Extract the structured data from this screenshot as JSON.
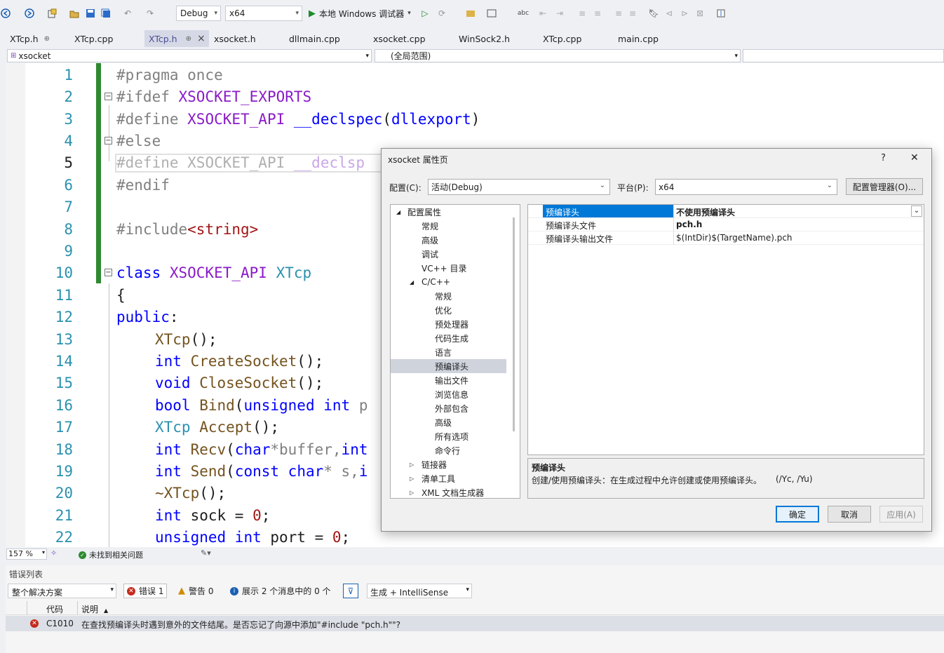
{
  "toolbar": {
    "config": "Debug",
    "platform": "x64",
    "run_label": "本地 Windows 调试器"
  },
  "tabs": [
    {
      "label": "XTcp.h",
      "pin": "⊕"
    },
    {
      "label": "XTcp.cpp"
    },
    {
      "label": "XTcp.h",
      "pin": "⊕",
      "close": "×"
    },
    {
      "label": "xsocket.h"
    },
    {
      "label": "dllmain.cpp"
    },
    {
      "label": "xsocket.cpp"
    },
    {
      "label": "WinSock2.h"
    },
    {
      "label": "XTcp.cpp"
    },
    {
      "label": "main.cpp"
    }
  ],
  "navbar": {
    "project": "xsocket",
    "scope": "(全局范围)"
  },
  "editor": {
    "current_line": "5",
    "line_numbers": [
      "1",
      "2",
      "3",
      "4",
      "5",
      "6",
      "7",
      "8",
      "9",
      "10",
      "11",
      "12",
      "13",
      "14",
      "15",
      "16",
      "17",
      "18",
      "19",
      "20",
      "21",
      "22"
    ],
    "lines": {
      "l1": {
        "a": "#pragma once"
      },
      "l2": {
        "a": "#ifdef ",
        "b": "XSOCKET_EXPORTS"
      },
      "l3": {
        "a": "#define ",
        "b": "XSOCKET_API",
        "c": " ",
        "d": "__declspec",
        "e": "(",
        "f": "dllexport",
        "g": ")"
      },
      "l4": {
        "a": "#else"
      },
      "l5": {
        "a": "#define ",
        "b": "XSOCKET_API",
        "c": " ",
        "d": "__declsp"
      },
      "l6": {
        "a": "#endif"
      },
      "l8": {
        "a": "#include",
        "b": "<string>"
      },
      "l10": {
        "a": "class ",
        "b": "XSOCKET_API",
        "c": " ",
        "d": "XTcp"
      },
      "l11": {
        "a": "{"
      },
      "l12": {
        "a": "public",
        ":": ":"
      },
      "l13": {
        "a": "XTcp",
        "b": "();"
      },
      "l14": {
        "a": "int ",
        "b": "CreateSocket",
        "c": "();"
      },
      "l15": {
        "a": "void ",
        "b": "CloseSocket",
        "c": "();"
      },
      "l16": {
        "a": "bool ",
        "b": "Bind",
        "c": "(",
        "d": "unsigned ",
        "e": "int ",
        "f": "p"
      },
      "l17": {
        "a": "XTcp ",
        "b": "Accept",
        "c": "();"
      },
      "l18": {
        "a": "int ",
        "b": "Recv",
        "c": "(",
        "d": "char",
        "e": "*buffer,",
        "f": "int"
      },
      "l19": {
        "a": "int ",
        "b": "Send",
        "c": "(",
        "d": "const ",
        "e": "char",
        "f": "* s,",
        "g": "i"
      },
      "l20": {
        "a": "~XTcp",
        "b": "();"
      },
      "l21": {
        "a": "int ",
        "b": "sock = ",
        "c": "0",
        ";": ";"
      },
      "l22": {
        "a": "unsigned ",
        "b": "int ",
        "c": "port = ",
        "d": "0",
        ";": ";"
      }
    }
  },
  "status": {
    "zoom": "157 %",
    "issues": "未找到相关问题"
  },
  "errors": {
    "panel_title": "错误列表",
    "scope": "整个解决方案",
    "errors_btn": "错误 1",
    "warnings_btn": "警告 0",
    "messages_btn": "展示 2 个消息中的 0 个",
    "build_filter": "生成 + IntelliSense",
    "col_code": "代码",
    "col_desc": "说明",
    "sort_arrow": "▲",
    "rows": [
      {
        "code": "C1010",
        "desc": "在查找预编译头时遇到意外的文件结尾。是否忘记了向源中添加\"#include \"pch.h\"\"?"
      }
    ]
  },
  "dialog": {
    "title": "xsocket 属性页",
    "help": "?",
    "close": "✕",
    "config_label": "配置(C):",
    "config_value": "活动(Debug)",
    "platform_label": "平台(P):",
    "platform_value": "x64",
    "config_manager": "配置管理器(O)...",
    "tree": [
      {
        "label": "配置属性",
        "exp": "◢"
      },
      {
        "label": "常规"
      },
      {
        "label": "高级"
      },
      {
        "label": "调试"
      },
      {
        "label": "VC++ 目录"
      },
      {
        "label": "C/C++",
        "exp": "◢"
      },
      {
        "label": "常规"
      },
      {
        "label": "优化"
      },
      {
        "label": "预处理器"
      },
      {
        "label": "代码生成"
      },
      {
        "label": "语言"
      },
      {
        "label": "预编译头"
      },
      {
        "label": "输出文件"
      },
      {
        "label": "浏览信息"
      },
      {
        "label": "外部包含"
      },
      {
        "label": "高级"
      },
      {
        "label": "所有选项"
      },
      {
        "label": "命令行"
      },
      {
        "label": "链接器",
        "exp": "▷"
      },
      {
        "label": "清单工具",
        "exp": "▷"
      },
      {
        "label": "XML 文档生成器",
        "exp": "▷"
      }
    ],
    "props": [
      {
        "name": "预编译头",
        "value": "不使用预编译头"
      },
      {
        "name": "预编译头文件",
        "value": "pch.h"
      },
      {
        "name": "预编译头输出文件",
        "value": "$(IntDir)$(TargetName).pch"
      }
    ],
    "desc_title": "预编译头",
    "desc_text": "创建/使用预编译头：在生成过程中允许创建或使用预编译头。",
    "desc_switch": "(/Yc, /Yu)",
    "ok": "确定",
    "cancel": "取消",
    "apply": "应用(A)"
  }
}
